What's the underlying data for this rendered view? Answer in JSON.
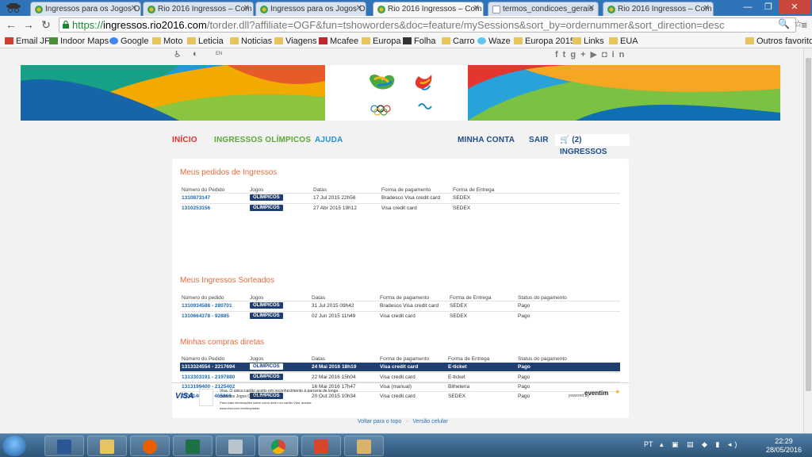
{
  "browser": {
    "tabs": [
      {
        "title": "Ingressos para os Jogos O",
        "icon": "rio-favicon"
      },
      {
        "title": "Rio 2016 Ingressos – Com",
        "icon": "rio-favicon"
      },
      {
        "title": "Ingressos para os Jogos O",
        "icon": "rio-favicon"
      },
      {
        "title": "Rio 2016 Ingressos – Com",
        "icon": "rio-favicon",
        "active": true
      },
      {
        "title": "termos_condicoes_gerais",
        "icon": "document-favicon"
      },
      {
        "title": "Rio 2016 Ingressos – Com",
        "icon": "rio-favicon"
      }
    ],
    "url_scheme": "https://",
    "url_host": "ingressos.rio2016.com",
    "url_path": "/torder.dll?affiliate=OGF&fun=tshoworders&doc=feature/mySessions&sort_by=ordernummer&sort_direction=desc",
    "bookmarks": [
      {
        "label": "Email JF",
        "icon": "gmail-icon"
      },
      {
        "label": "Indoor Maps",
        "icon": "maps-icon"
      },
      {
        "label": "Google",
        "icon": "google-icon"
      },
      {
        "label": "Moto",
        "icon": "folder-icon"
      },
      {
        "label": "Leticia",
        "icon": "folder-icon"
      },
      {
        "label": "Noticias",
        "icon": "folder-icon"
      },
      {
        "label": "Viagens",
        "icon": "folder-icon"
      },
      {
        "label": "Mcafee",
        "icon": "shield-icon"
      },
      {
        "label": "Europa",
        "icon": "folder-icon"
      },
      {
        "label": "Folha",
        "icon": "folha-icon"
      },
      {
        "label": "Carro",
        "icon": "folder-icon"
      },
      {
        "label": "Waze",
        "icon": "waze-icon"
      },
      {
        "label": "Europa 2015",
        "icon": "folder-icon"
      },
      {
        "label": "Links",
        "icon": "folder-icon"
      },
      {
        "label": "EUA",
        "icon": "folder-icon"
      }
    ],
    "other_bookmarks": "Outros favoritos"
  },
  "site": {
    "lang": "EN",
    "nav": {
      "home": "INÍCIO",
      "olympic_tickets": "INGRESSOS OLÍMPICOS",
      "help": "AJUDA",
      "account": "MINHA CONTA",
      "logout": "SAIR",
      "cart": "(2) INGRESSOS"
    },
    "colors": {
      "home": "#e0312b",
      "olympic": "#5aa83a",
      "help": "#2a8fd0",
      "account": "#1f4e87",
      "accent_orange": "#e86a3a",
      "navy": "#1f3f73"
    }
  },
  "orders": {
    "title": "Meus pedidos de Ingressos",
    "headers": [
      "Número do Pedido",
      "Jogos",
      "Datas",
      "Forma de pagamento",
      "Forma de Entrega"
    ],
    "rows": [
      {
        "order": "1310873147",
        "games": "OLÍMPICOS",
        "date": "17 Jul 2015 22h56",
        "payment": "Bradesco Visa credit card",
        "delivery": "SEDEX"
      },
      {
        "order": "1310253156",
        "games": "OLÍMPICOS",
        "date": "27 Abr 2015 19h12",
        "payment": "Visa credit card",
        "delivery": "SEDEX"
      }
    ]
  },
  "lottery": {
    "title": "Meus Ingressos Sorteados",
    "headers": [
      "Número do pedido",
      "Jogos",
      "Datas",
      "Forma de pagamento",
      "Forma de Entrega",
      "Status do pagamento"
    ],
    "rows": [
      {
        "order": "1310934588 - 280701",
        "games": "OLÍMPICOS",
        "date": "31 Jul 2015 09h42",
        "payment": "Bradesco Visa credit card",
        "delivery": "SEDEX",
        "status": "Pago"
      },
      {
        "order": "1310664378 - 92885",
        "games": "OLÍMPICOS",
        "date": "02 Jun 2015 11h49",
        "payment": "Visa credit card",
        "delivery": "SEDEX",
        "status": "Pago"
      }
    ]
  },
  "direct": {
    "title": "Minhas compras diretas",
    "headers": [
      "Número do Pedido",
      "Jogos",
      "Datas",
      "Forma de pagamento",
      "Forma de Entrega",
      "Status do pagamento"
    ],
    "rows": [
      {
        "order": "1313324554 - 2217694",
        "games": "OLÍMPICOS",
        "date": "24 Mai 2016 18h19",
        "payment": "Visa credit card",
        "delivery": "E-ticket",
        "status": "Pago",
        "selected": true
      },
      {
        "order": "1313303191 - 2197880",
        "games": "OLÍMPICOS",
        "date": "22 Mai 2016 15h04",
        "payment": "Visa credit card",
        "delivery": "E-ticket",
        "status": "Pago"
      },
      {
        "order": "1313199400 - 2125402",
        "games": "",
        "date": "16 Mai 2016 17h47",
        "payment": "Visa (manual)",
        "delivery": "Bilheteria",
        "status": "Pago"
      },
      {
        "order": "1311146613 - 465968",
        "games": "OLÍMPICOS",
        "date": "20 Out 2015 10h34",
        "payment": "Visa credit card",
        "delivery": "SEDEX",
        "status": "Pago"
      }
    ]
  },
  "footer": {
    "visa": "VISA",
    "visa_text": "Visa. O único cartão aceito em reconhecimento à parceria de longa data nos Jogos Olímpicos.",
    "visa_small": "Para mais informações sobre como obter um cartão Visa, acesse www.visa.com.br/olimpiadas",
    "powered_by": "powered by",
    "eventim": "eventim",
    "back_to_top": "Voltar para o topo",
    "separator": "-",
    "mobile": "Versão celular"
  },
  "taskbar": {
    "lang": "PT",
    "time": "22:29",
    "date": "28/05/2016"
  }
}
